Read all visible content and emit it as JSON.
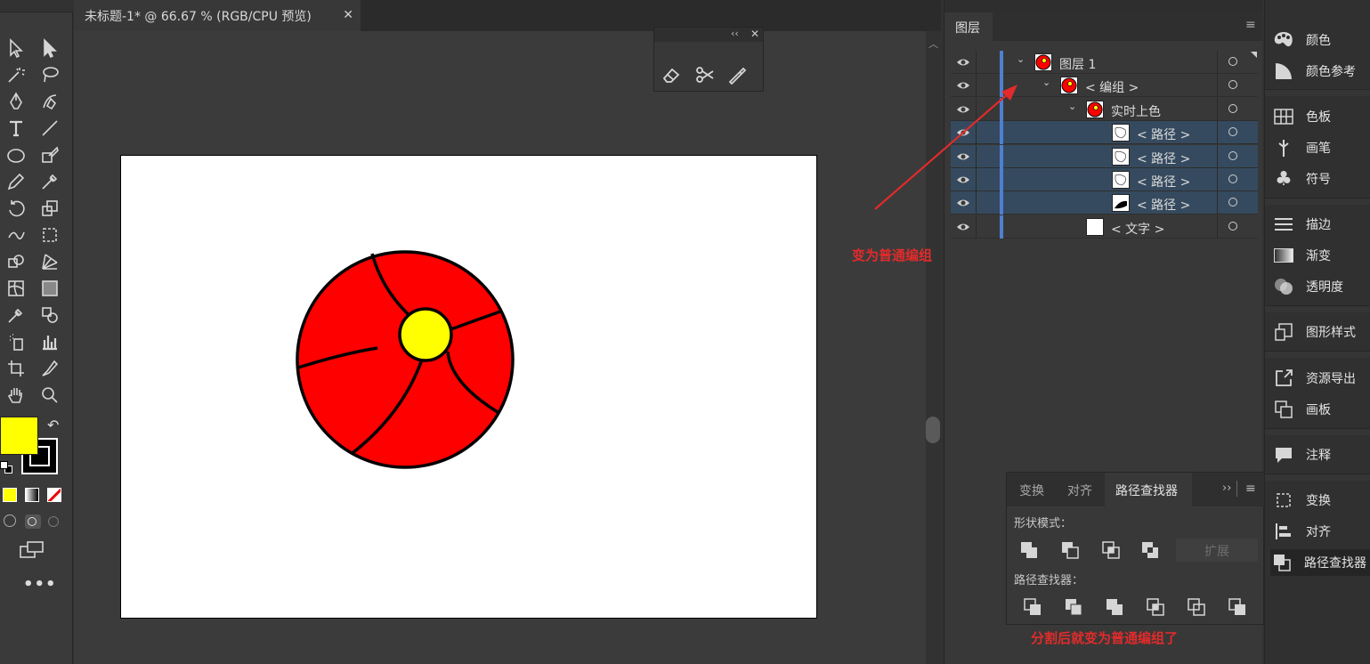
{
  "document": {
    "tab_title": "未标题-1* @ 66.67 % (RGB/CPU 预览)",
    "close": "✕"
  },
  "float_panel": {
    "collapse": "‹‹",
    "close": "✕",
    "tools": [
      "eraser-icon",
      "scissors-icon",
      "knife-icon"
    ]
  },
  "layers_panel": {
    "title": "图层",
    "rows": [
      {
        "label": "图层  1",
        "thumb": "circle",
        "expanded": true,
        "selected": false
      },
      {
        "label": "< 编组 >",
        "thumb": "circle",
        "expanded": true,
        "selected": false
      },
      {
        "label": "实时上色",
        "thumb": "circle",
        "expanded": true,
        "selected": false
      },
      {
        "label": "< 路径 >",
        "thumb": "path",
        "selected": true
      },
      {
        "label": "< 路径 >",
        "thumb": "path",
        "selected": true
      },
      {
        "label": "< 路径 >",
        "thumb": "path",
        "selected": true
      },
      {
        "label": "< 路径 >",
        "thumb": "path-black",
        "selected": true
      },
      {
        "label": "< 文字 >",
        "thumb": "blank",
        "selected": false
      }
    ]
  },
  "annotations": {
    "top": "变为普通编组",
    "bottom": "分割后就变为普通编组了"
  },
  "pathfinder": {
    "tabs": [
      "变换",
      "对齐",
      "路径查找器"
    ],
    "active_tab": "路径查找器",
    "shape_modes_label": "形状模式：",
    "expand_button": "扩展",
    "pathfinders_label": "路径查找器："
  },
  "right_dock": {
    "items": [
      "颜色",
      "颜色参考",
      "色板",
      "画笔",
      "符号",
      "描边",
      "渐变",
      "透明度",
      "图形样式",
      "资源导出",
      "画板",
      "注释",
      "变换",
      "对齐",
      "路径查找器"
    ]
  },
  "colors": {
    "fill": "#ffff00",
    "stroke": "#000000",
    "ball_red": "#ff0000",
    "selection": "#354a5e",
    "layer_bar": "#4f7fd1"
  }
}
